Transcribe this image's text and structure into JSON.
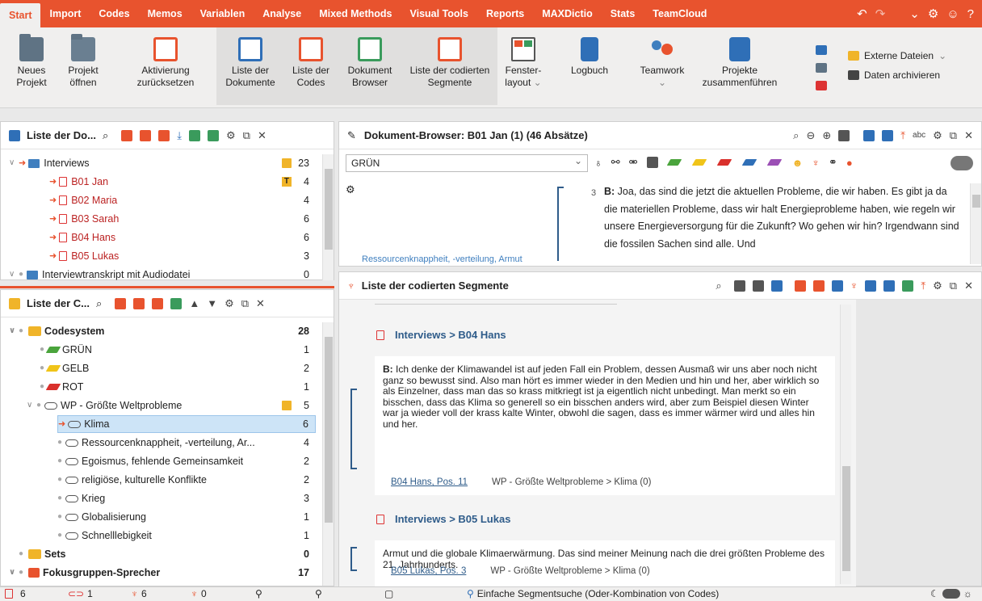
{
  "menu": [
    "Start",
    "Import",
    "Codes",
    "Memos",
    "Variablen",
    "Analyse",
    "Mixed Methods",
    "Visual Tools",
    "Reports",
    "MAXDictio",
    "Stats",
    "TeamCloud"
  ],
  "ribbon": {
    "neues_projekt": [
      "Neues",
      "Projekt"
    ],
    "projekt_oeffnen": [
      "Projekt",
      "öffnen"
    ],
    "aktivierung": [
      "Aktivierung",
      "zurücksetzen"
    ],
    "liste_dokumente": [
      "Liste der",
      "Dokumente"
    ],
    "liste_codes": [
      "Liste der",
      "Codes"
    ],
    "dokument_browser": [
      "Dokument",
      "Browser"
    ],
    "liste_segmente": [
      "Liste der codierten",
      "Segmente"
    ],
    "fensterlayout": [
      "Fenster-",
      "layout"
    ],
    "logbuch": "Logbuch",
    "teamwork": "Teamwork",
    "projekte_zusammen": [
      "Projekte",
      "zusammenführen"
    ],
    "externe_dateien": "Externe Dateien",
    "daten_archivieren": "Daten archivieren"
  },
  "doclist": {
    "title": "Liste der Do...",
    "rows": [
      {
        "label": "Interviews",
        "count": "23"
      },
      {
        "label": "B01 Jan",
        "count": "4"
      },
      {
        "label": "B02 Maria",
        "count": "4"
      },
      {
        "label": "B03 Sarah",
        "count": "6"
      },
      {
        "label": "B04 Hans",
        "count": "6"
      },
      {
        "label": "B05 Lukas",
        "count": "3"
      },
      {
        "label": "Interviewtranskript mit Audiodatei",
        "count": "0"
      }
    ]
  },
  "codelist": {
    "title": "Liste der C...",
    "rows": [
      {
        "label": "Codesystem",
        "count": "28"
      },
      {
        "label": "GRÜN",
        "count": "1"
      },
      {
        "label": "GELB",
        "count": "2"
      },
      {
        "label": "ROT",
        "count": "1"
      },
      {
        "label": "WP - Größte Weltprobleme",
        "count": "5"
      },
      {
        "label": "Klima",
        "count": "6"
      },
      {
        "label": "Ressourcenknappheit, -verteilung, Ar...",
        "count": "4"
      },
      {
        "label": "Egoismus, fehlende Gemeinsamkeit",
        "count": "2"
      },
      {
        "label": "religiöse, kulturelle Konflikte",
        "count": "2"
      },
      {
        "label": "Krieg",
        "count": "3"
      },
      {
        "label": "Globalisierung",
        "count": "1"
      },
      {
        "label": "Schnelllebigkeit",
        "count": "1"
      },
      {
        "label": "Sets",
        "count": "0"
      },
      {
        "label": "Fokusgruppen-Sprecher",
        "count": "17"
      }
    ]
  },
  "docbrowser": {
    "title": "Dokument-Browser: B01 Jan (1)  (46 Absätze)",
    "combo": "GRÜN",
    "para_no": "3",
    "speaker": "B:",
    "text": " Joa, das sind die jetzt die aktuellen Probleme, die wir haben. Es gibt ja da die materiellen Probleme, dass wir halt Energieprobleme haben, wie regeln wir unsere Energieversorgung für die Zukunft? Wo gehen wir hin? Irgendwann sind die fossilen Sachen sind alle. Und",
    "margin_code": "Ressourcenknappheit, -verteilung, Armut"
  },
  "segments": {
    "title": "Liste der codierten Segmente",
    "items": [
      {
        "head": "Interviews > B04 Hans",
        "speaker": "B:",
        "text": " Ich denke der Klimawandel ist auf jeden Fall ein Problem, dessen Ausmaß wir uns aber noch nicht ganz so bewusst sind. Also man hört es immer wieder in den Medien und hin und her, aber wirklich so als Einzelner, dass man das so krass mitkriegt ist ja eigentlich nicht unbedingt. Man merkt so ein bisschen, dass das Klima so generell so ein bisschen anders wird, aber zum Beispiel diesen Winter war ja wieder voll der krass kalte Winter, obwohl die sagen, dass es immer wärmer wird und alles hin und her.",
        "source": "B04 Hans, Pos. 11",
        "code": "WP - Größte Weltprobleme > Klima (0)"
      },
      {
        "head": "Interviews > B05 Lukas",
        "speaker": "",
        "text": "Armut und die globale Klimaerwärmung. Das sind meiner Meinung nach die drei größten Probleme des 21. Jahrhunderts.",
        "source": "B05 Lukas, Pos. 3",
        "code": "WP - Größte Weltprobleme > Klima (0)"
      }
    ]
  },
  "status": {
    "docs": "6",
    "memos": "1",
    "segments": "6",
    "codes": "0",
    "search": "Einfache Segmentsuche (Oder-Kombination von Codes)"
  }
}
